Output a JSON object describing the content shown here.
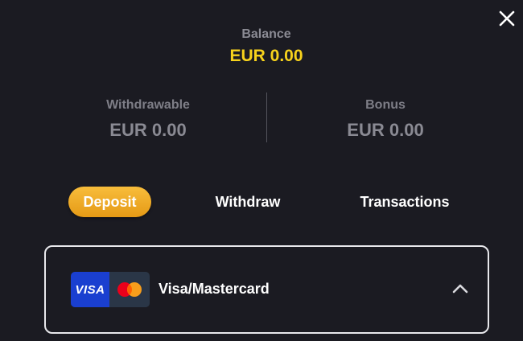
{
  "close_icon": "close-icon",
  "balance": {
    "label": "Balance",
    "value": "EUR 0.00",
    "value_color": "#f7d21c"
  },
  "withdrawable": {
    "label": "Withdrawable",
    "value": "EUR 0.00"
  },
  "bonus": {
    "label": "Bonus",
    "value": "EUR 0.00"
  },
  "tabs": [
    {
      "label": "Deposit",
      "active": true
    },
    {
      "label": "Withdraw",
      "active": false
    },
    {
      "label": "Transactions",
      "active": false
    }
  ],
  "accent_color": "#f2aa2a",
  "payment_method": {
    "visa_text": "VISA",
    "label": "Visa/Mastercard",
    "icons": [
      "visa-icon",
      "mastercard-icon",
      "chevron-up-icon"
    ]
  }
}
